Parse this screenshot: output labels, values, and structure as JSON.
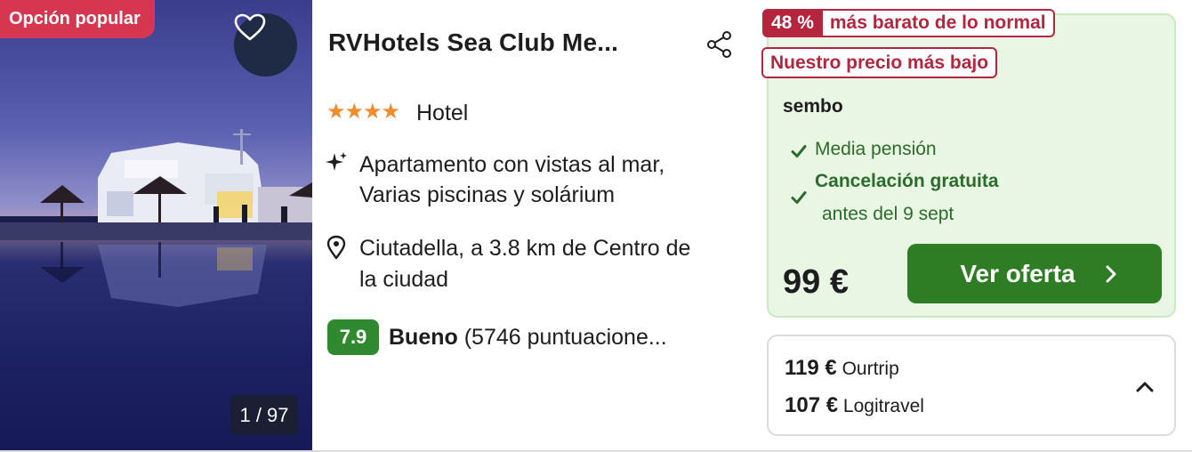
{
  "photo": {
    "badge_label": "Opción popular",
    "counter": "1 / 97",
    "alt": "Hotel exterior at dusk with pool reflection"
  },
  "hotel": {
    "name": "RVHotels Sea Club Me...",
    "stars": "★★★★",
    "star_count": 4,
    "category": "Hotel",
    "features_line1": "Apartamento con vistas al mar,",
    "features_line2": "Varias piscinas y solárium",
    "location_line1": "Ciutadella, a 3.8 km de Centro de",
    "location_line2": "la ciudad",
    "rating_score": "7.9",
    "rating_word": "Bueno",
    "rating_count": " (5746 puntuacione..."
  },
  "offer": {
    "discount_pct": "48 %",
    "discount_text": "más barato de lo normal",
    "lowest_label": "Nuestro precio más bajo",
    "provider": "sembo",
    "perk_board": "Media pensión",
    "perk_cancel": "Cancelación gratuita",
    "perk_cancel_sub": "antes del 9 sept",
    "price": "99 €",
    "cta_label": "Ver oferta"
  },
  "other_offers": [
    {
      "price": "119 €",
      "provider": "Ourtrip"
    },
    {
      "price": "107 €",
      "provider": "Logitravel"
    }
  ],
  "colors": {
    "popular_badge": "#d6364f",
    "deal_red": "#b3263e",
    "rating_green": "#2f8a2f",
    "cta_green": "#2e7d24",
    "offer_bg": "#e8f6e3",
    "star_orange": "#f08c2c"
  },
  "icons": {
    "favorite": "heart-icon",
    "share": "share-icon",
    "features": "sparkle-icon",
    "location": "map-pin-icon",
    "perk": "checkmark-icon",
    "cta": "chevron-right-icon",
    "expand": "chevron-up-icon"
  }
}
